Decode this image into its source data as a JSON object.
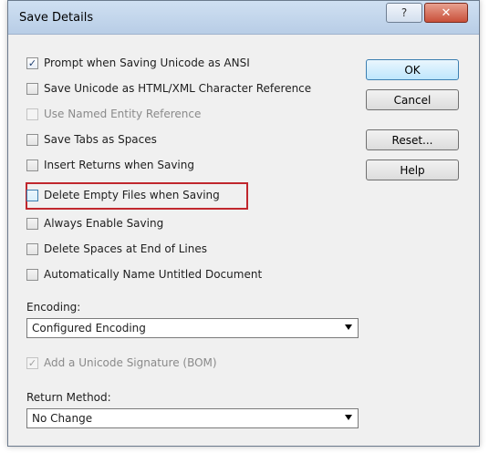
{
  "window": {
    "title": "Save Details",
    "help_glyph": "?",
    "close_glyph": "✕"
  },
  "checkboxes": [
    {
      "label": "Prompt when Saving Unicode as ANSI",
      "checked": true,
      "disabled": false
    },
    {
      "label": "Save Unicode as HTML/XML Character Reference",
      "checked": false,
      "disabled": false
    },
    {
      "label": "Use Named Entity Reference",
      "checked": false,
      "disabled": true
    },
    {
      "label": "Save Tabs as Spaces",
      "checked": false,
      "disabled": false
    },
    {
      "label": "Insert Returns when Saving",
      "checked": false,
      "disabled": false
    },
    {
      "label": "Delete Empty Files when Saving",
      "checked": false,
      "disabled": false,
      "highlighted": true
    },
    {
      "label": "Always Enable Saving",
      "checked": false,
      "disabled": false
    },
    {
      "label": "Delete Spaces at End of Lines",
      "checked": false,
      "disabled": false
    },
    {
      "label": "Automatically Name Untitled Document",
      "checked": false,
      "disabled": false
    }
  ],
  "buttons": {
    "ok": "OK",
    "cancel": "Cancel",
    "reset": "Reset...",
    "help": "Help"
  },
  "encoding": {
    "label": "Encoding:",
    "value": "Configured Encoding"
  },
  "bom": {
    "label": "Add a Unicode Signature (BOM)",
    "checked": true,
    "disabled": true
  },
  "return_method": {
    "label": "Return Method:",
    "value": "No Change"
  },
  "check_glyph": "✓",
  "colors": {
    "highlight_box": "#c0272d",
    "default_button_border": "#3c7fb1"
  }
}
